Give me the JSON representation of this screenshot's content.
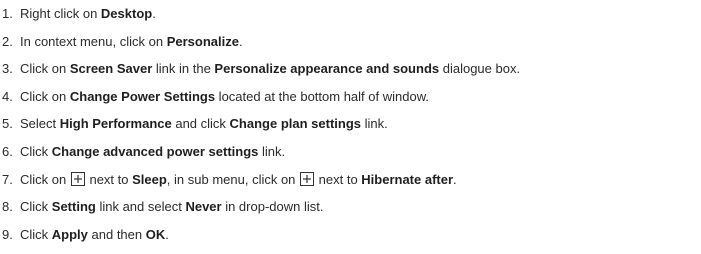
{
  "steps": [
    {
      "number": "1.",
      "parts": [
        {
          "t": "Right click on "
        },
        {
          "b": "Desktop"
        },
        {
          "t": "."
        }
      ]
    },
    {
      "number": "2.",
      "parts": [
        {
          "t": "In context menu, click on "
        },
        {
          "b": "Personalize"
        },
        {
          "t": "."
        }
      ]
    },
    {
      "number": "3.",
      "parts": [
        {
          "t": "Click on "
        },
        {
          "b": "Screen Saver"
        },
        {
          "t": " link in the "
        },
        {
          "b": "Personalize appearance and sounds"
        },
        {
          "t": " dialogue box."
        }
      ]
    },
    {
      "number": "4.",
      "parts": [
        {
          "t": "Click on "
        },
        {
          "b": "Change Power Settings"
        },
        {
          "t": " located at the bottom half of window."
        }
      ]
    },
    {
      "number": "5.",
      "parts": [
        {
          "t": "Select "
        },
        {
          "b": "High Performance"
        },
        {
          "t": " and click "
        },
        {
          "b": "Change plan settings"
        },
        {
          "t": " link."
        }
      ]
    },
    {
      "number": "6.",
      "parts": [
        {
          "t": "Click "
        },
        {
          "b": "Change advanced power settings"
        },
        {
          "t": " link."
        }
      ]
    },
    {
      "number": "7.",
      "parts": [
        {
          "t": "Click on "
        },
        {
          "icon": "expand-plus-icon"
        },
        {
          "t": " next to "
        },
        {
          "b": "Sleep"
        },
        {
          "t": ", in sub menu, click on "
        },
        {
          "icon": "expand-plus-icon"
        },
        {
          "t": " next to "
        },
        {
          "b": "Hibernate after"
        },
        {
          "t": "."
        }
      ]
    },
    {
      "number": "8.",
      "parts": [
        {
          "t": "Click "
        },
        {
          "b": "Setting"
        },
        {
          "t": " link and select "
        },
        {
          "b": "Never"
        },
        {
          "t": " in drop-down list."
        }
      ]
    },
    {
      "number": "9.",
      "parts": [
        {
          "t": "Click "
        },
        {
          "b": "Apply"
        },
        {
          "t": " and then "
        },
        {
          "b": "OK"
        },
        {
          "t": "."
        }
      ]
    }
  ]
}
